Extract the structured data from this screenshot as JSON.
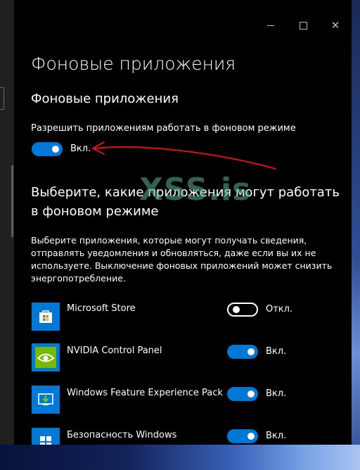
{
  "window": {
    "controls": [
      "minimize",
      "maximize",
      "close"
    ],
    "close_glyph": "✕"
  },
  "page_title": "Фоновые приложения",
  "section_title": "Фоновые приложения",
  "allow_background": {
    "label": "Разрешить приложениям работать в фоновом режиме",
    "state": "on",
    "state_text": "Вкл."
  },
  "choose_heading": "Выберите, какие приложения могут работать в фоновом режиме",
  "choose_description": "Выберите приложения, которые могут получать сведения, отправлять уведомления и обновляться, даже если вы их не используете. Выключение фоновых приложений может снизить энергопотребление.",
  "apps": [
    {
      "name": "Microsoft Store",
      "state": "off",
      "state_text": "Откл.",
      "icon": "microsoft-store-icon"
    },
    {
      "name": "NVIDIA Control Panel",
      "state": "on",
      "state_text": "Вкл.",
      "icon": "nvidia-icon"
    },
    {
      "name": "Windows Feature Experience Pack",
      "state": "on",
      "state_text": "Вкл.",
      "icon": "feature-pack-icon"
    },
    {
      "name": "Безопасность Windows",
      "state": "on",
      "state_text": "Вкл.",
      "icon": "windows-security-icon"
    }
  ],
  "watermark": "XSS.is",
  "colors": {
    "window_bg": "#000000",
    "accent": "#0078d7",
    "app_tile": "#0078d7",
    "nvidia_green": "#76b900",
    "annotation_red": "#e01010"
  }
}
